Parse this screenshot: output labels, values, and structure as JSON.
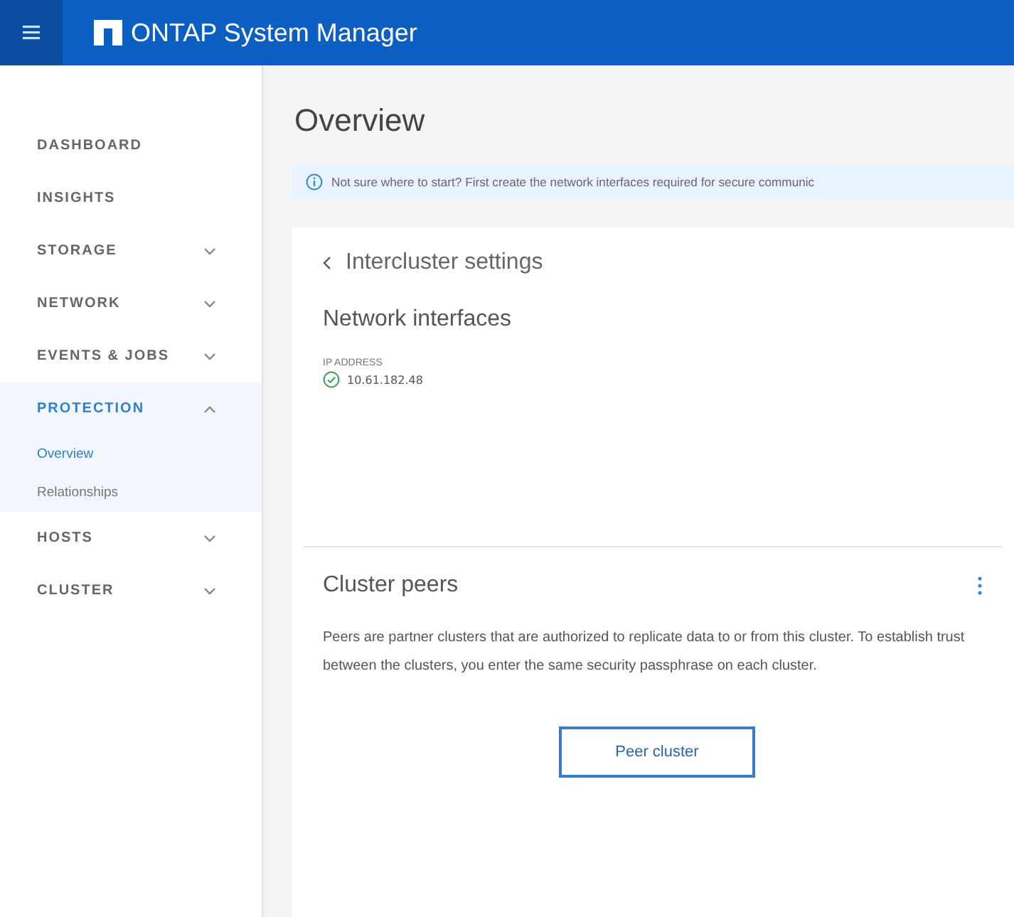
{
  "header": {
    "title": "ONTAP System Manager"
  },
  "sidebar": {
    "items": [
      {
        "label": "DASHBOARD",
        "kind": "link",
        "selected": false
      },
      {
        "label": "INSIGHTS",
        "kind": "link",
        "selected": false
      },
      {
        "label": "STORAGE",
        "kind": "group",
        "selected": false,
        "expanded": false
      },
      {
        "label": "NETWORK",
        "kind": "group",
        "selected": false,
        "expanded": false
      },
      {
        "label": "EVENTS & JOBS",
        "kind": "group",
        "selected": false,
        "expanded": false
      },
      {
        "label": "PROTECTION",
        "kind": "group",
        "selected": true,
        "expanded": true,
        "children": [
          {
            "label": "Overview",
            "selected": true
          },
          {
            "label": "Relationships",
            "selected": false
          }
        ]
      },
      {
        "label": "HOSTS",
        "kind": "group",
        "selected": false,
        "expanded": false
      },
      {
        "label": "CLUSTER",
        "kind": "group",
        "selected": false,
        "expanded": false
      }
    ]
  },
  "page": {
    "title": "Overview",
    "banner": "Not sure where to start? First create the network interfaces required for secure communic"
  },
  "intercluster": {
    "back_label": "Intercluster settings",
    "section_title": "Network interfaces",
    "column_label": "IP ADDRESS",
    "addresses": [
      {
        "value": "10.61.182.48"
      }
    ]
  },
  "cluster_peers": {
    "title": "Cluster peers",
    "description": "Peers are partner clusters that are authorized to replicate data to or from this cluster. To establish trust between the clusters, you enter the same security passphrase on each cluster.",
    "button": "Peer cluster"
  }
}
